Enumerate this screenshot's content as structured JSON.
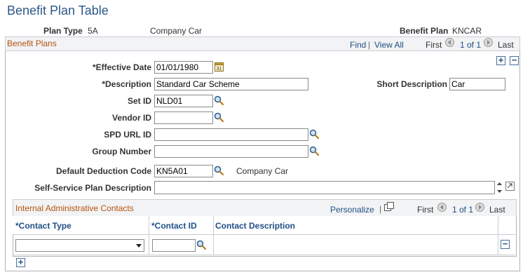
{
  "page": {
    "title": "Benefit Plan Table",
    "plan_type_label": "Plan Type",
    "plan_type_value": "5A",
    "plan_type_desc": "Company Car",
    "benefit_plan_label": "Benefit Plan",
    "benefit_plan_value": "KNCAR"
  },
  "benefit_plans": {
    "title": "Benefit Plans",
    "find": "Find",
    "view_all": "View All",
    "first": "First",
    "count": "1 of 1",
    "last": "Last"
  },
  "form": {
    "effective_date_label": "*Effective Date",
    "effective_date": "01/01/1980",
    "description_label": "*Description",
    "description": "Standard Car Scheme",
    "short_desc_label": "Short Description",
    "short_desc": "Car",
    "setid_label": "Set ID",
    "setid": "NLD01",
    "vendor_label": "Vendor ID",
    "vendor": "",
    "spd_label": "SPD URL ID",
    "spd": "",
    "group_label": "Group Number",
    "group": "",
    "deduction_label": "Default Deduction Code",
    "deduction": "KN5A01",
    "deduction_desc": "Company Car",
    "ss_label": "Self-Service Plan Description",
    "ss": ""
  },
  "contacts": {
    "title": "Internal Administrative Contacts",
    "personalize": "Personalize",
    "first": "First",
    "count": "1 of 1",
    "last": "Last",
    "col_type": "*Contact Type",
    "col_id": "*Contact ID",
    "col_desc": "Contact Description",
    "row_type": "",
    "row_id": "",
    "row_desc": ""
  },
  "icons": {
    "calendar": "calendar-icon",
    "lookup": "magnifier-icon",
    "add": "plus-icon",
    "delete": "minus-icon"
  },
  "colors": {
    "title": "#2d5887",
    "section_title": "#b5530d",
    "link": "#1f4f86"
  }
}
